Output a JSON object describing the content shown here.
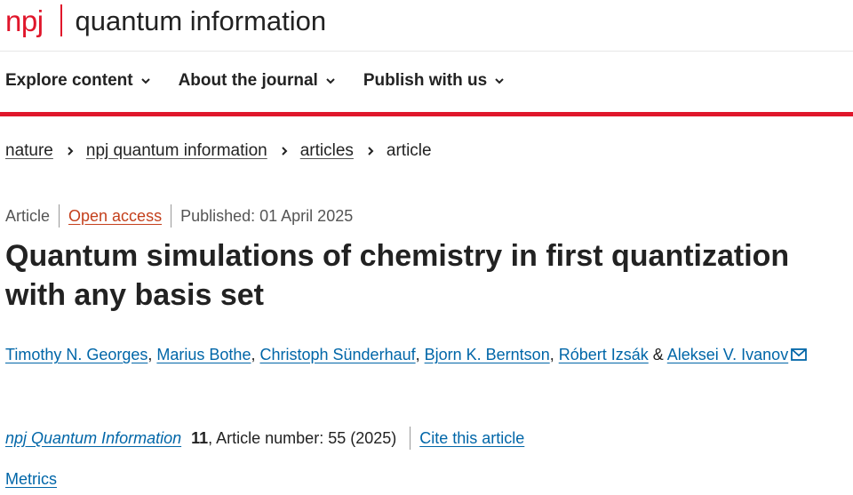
{
  "brand": {
    "logo_text": "npj",
    "journal_name": "quantum information"
  },
  "nav": [
    {
      "label": "Explore content"
    },
    {
      "label": "About the journal"
    },
    {
      "label": "Publish with us"
    }
  ],
  "breadcrumb": {
    "items": [
      "nature",
      "npj quantum information",
      "articles"
    ],
    "current": "article"
  },
  "article": {
    "type": "Article",
    "access": "Open access",
    "published": "Published: 01 April 2025",
    "title": "Quantum simulations of chemistry in first quantization with any basis set",
    "authors": [
      "Timothy N. Georges",
      "Marius Bothe",
      "Christoph Sünderhauf",
      "Bjorn K. Berntson",
      "Róbert Izsák",
      "Aleksei V. Ivanov"
    ],
    "citation": {
      "journal": "npj Quantum Information",
      "volume": "11",
      "rest": ", Article number: 55 (2025)",
      "cite_link": "Cite this article"
    },
    "metrics_link": "Metrics"
  },
  "colors": {
    "brand_red": "#e0162b",
    "link_blue": "#0066a8",
    "open_access_orange": "#c4401c"
  },
  "icons": [
    "chevron-down-icon",
    "chevron-right-icon",
    "envelope-icon"
  ]
}
